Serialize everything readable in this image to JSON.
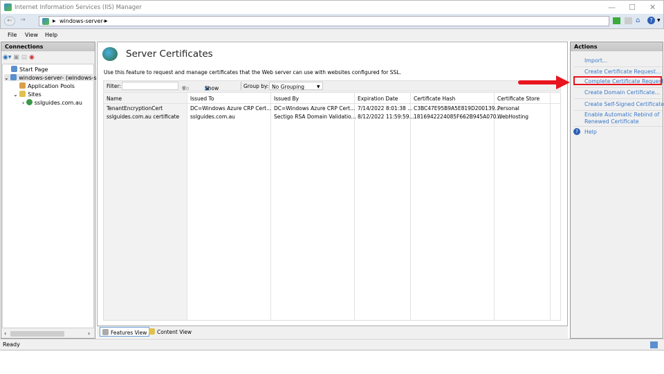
{
  "window": {
    "title": "Internet Information Services (IIS) Manager"
  },
  "address": {
    "path": "windows-server-"
  },
  "menu": [
    "File",
    "View",
    "Help"
  ],
  "connections": {
    "header": "Connections",
    "tree": [
      "Start Page",
      "windows-server- (windows-se",
      "Application Pools",
      "Sites",
      "sslguides.com.au"
    ]
  },
  "main": {
    "title": "Server Certificates",
    "description": "Use this feature to request and manage certificates that the Web server can use with websites configured for SSL.",
    "filter_label": "Filter:",
    "filter_value": "",
    "go_label": "Go",
    "show_all_label": "Show All",
    "group_by_label": "Group by:",
    "group_by_value": "No Grouping",
    "columns": [
      "Name",
      "Issued To",
      "Issued By",
      "Expiration Date",
      "Certificate Hash",
      "Certificate Store"
    ],
    "rows": [
      [
        "TenantEncryptionCert",
        "DC=Windows Azure CRP Cert...",
        "DC=Windows Azure CRP Cert...",
        "7/14/2022 8:01:38 ...",
        "C3BC47E95B9A5E819D200139...",
        "Personal"
      ],
      [
        "sslguides.com.au certificate",
        "sslguides.com.au",
        "Sectigo RSA Domain Validatio...",
        "8/12/2022 11:59:59...",
        "1816942224085F662B945A070...",
        "WebHosting"
      ]
    ],
    "tabs": [
      "Features View",
      "Content View"
    ]
  },
  "actions": {
    "header": "Actions",
    "items": [
      "Import...",
      "Create Certificate Request...",
      "Complete Certificate Request...",
      "Create Domain Certificate...",
      "Create Self-Signed Certificate...",
      "Enable Automatic Rebind of",
      "Renewed Certificate",
      "Help"
    ],
    "highlighted": "Complete Certificate Request...",
    "highlight_color": "#e8141e",
    "link_color": "#3a78c8"
  },
  "status": {
    "text": "Ready"
  }
}
